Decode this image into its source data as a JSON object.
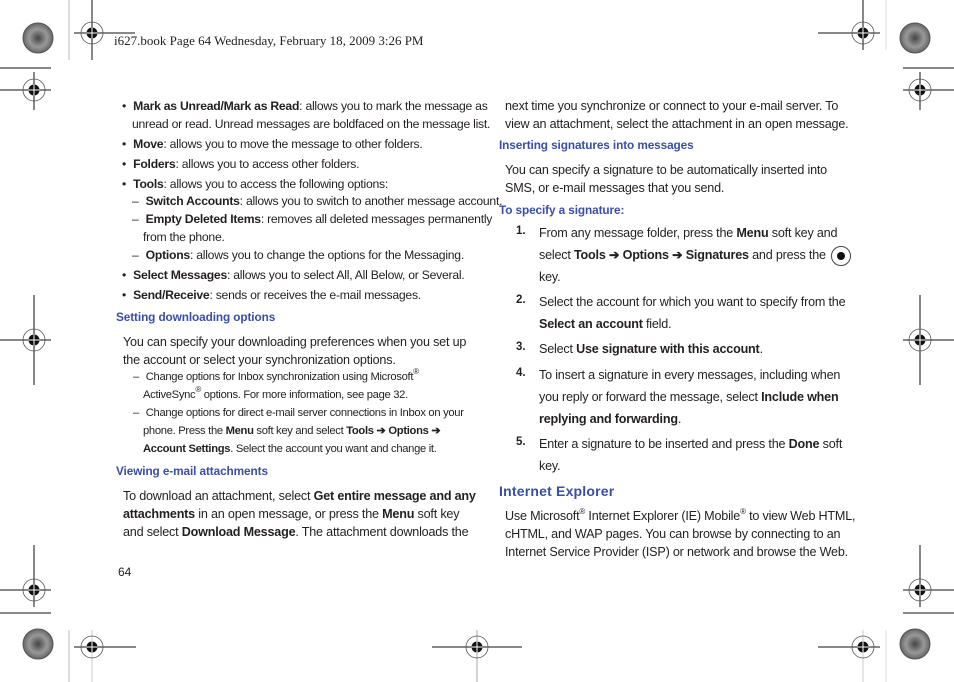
{
  "header": {
    "running_head": "i627.book  Page 64  Wednesday, February 18, 2009  3:26 PM"
  },
  "left_column": {
    "bullets": [
      {
        "term": "Mark as Unread/Mark as Read",
        "desc_line1": ": allows you to mark the message as",
        "desc_line2": "unread or read. Unread messages are boldfaced on the message list."
      },
      {
        "term": "Move",
        "desc": ": allows you to move the message to other folders."
      },
      {
        "term": "Folders",
        "desc": ": allows you to access other folders."
      },
      {
        "term": "Tools",
        "desc": ": allows you to access the following options:"
      }
    ],
    "tools_subitems": [
      {
        "term": "Switch Accounts",
        "desc": ": allows you to switch to another message account."
      },
      {
        "term": "Empty Deleted Items",
        "desc_line1": ": removes all deleted messages permanently",
        "desc_line2": "from the phone."
      },
      {
        "term": "Options",
        "desc": ": allows you to change the options for the Messaging."
      }
    ],
    "bullets2": [
      {
        "term": "Select Messages",
        "desc": ": allows you to select All, All Below, or Several."
      },
      {
        "term": "Send/Receive",
        "desc": ": sends or receives the e-mail messages."
      }
    ],
    "section_downloading": {
      "heading": "Setting downloading options",
      "para_line1": "You can specify your downloading preferences when you set up",
      "para_line2": "the account or select your synchronization options.",
      "sub1_line1": "Change options for Inbox synchronization using Microsoft",
      "sub1_line2a": "ActiveSync",
      "sub1_line2b": " options. For more information, see page 32.",
      "sub2_line1": "Change options for direct e-mail server connections in Inbox on your",
      "sub2_line2a": "phone. Press the ",
      "sub2_menu": "Menu",
      "sub2_line2b": " soft key and select ",
      "sub2_path": "Tools ➔ Options ➔",
      "sub2_line3a": "Account Settings",
      "sub2_line3b": ". Select the account you want and change it."
    },
    "section_attachments": {
      "heading": "Viewing e-mail attachments",
      "l1a": "To download an attachment, select ",
      "l1b": "Get entire message and any",
      "l2a": "attachments",
      "l2b": " in an open message, or press the ",
      "l2c": "Menu",
      "l2d": " soft key",
      "l3a": "and select ",
      "l3b": "Download Message",
      "l3c": ". The attachment downloads the"
    },
    "page_number": "64"
  },
  "right_column": {
    "cont_line1": "next time you synchronize or connect to your e-mail server. To",
    "cont_line2": "view an attachment, select the attachment in an open message.",
    "section_signatures": {
      "heading": "Inserting signatures into messages",
      "para_line1": "You can specify a signature to be automatically inserted into",
      "para_line2": "SMS, or e-mail messages that you send.",
      "subheading": "To specify a signature:",
      "steps": [
        {
          "num": "1.",
          "l1a": "From any message folder, press the ",
          "l1b": "Menu",
          "l1c": " soft key and",
          "l2a": "select ",
          "l2b": "Tools ➔ Options ➔ Signatures",
          "l2c": " and press the",
          "l3": "key."
        },
        {
          "num": "2.",
          "l1": "Select the account for which you want to specify from the",
          "l2a": "Select an account",
          "l2b": " field."
        },
        {
          "num": "3.",
          "l1a": "Select ",
          "l1b": "Use signature with this account",
          "l1c": "."
        },
        {
          "num": "4.",
          "l1": "To insert a signature in every messages, including when",
          "l2a": "you reply or forward the message, select ",
          "l2b": "Include when",
          "l3a": "replying and forwarding",
          "l3b": "."
        },
        {
          "num": "5.",
          "l1a": "Enter a signature to be inserted and press the ",
          "l1b": "Done",
          "l1c": " soft",
          "l2": "key."
        }
      ]
    },
    "section_ie": {
      "heading": "Internet Explorer",
      "l1a": "Use Microsoft",
      "l1b": " Internet Explorer (IE) Mobile",
      "l1c": " to view Web HTML,",
      "l2": "cHTML, and WAP pages. You can browse by connecting to an",
      "l3": "Internet Service Provider (ISP) or network and browse the Web."
    }
  },
  "symbols": {
    "registered": "®",
    "bullet": "•",
    "dash": "–"
  },
  "colors": {
    "heading_blue": "#3a4ea6",
    "text": "#231f20"
  }
}
